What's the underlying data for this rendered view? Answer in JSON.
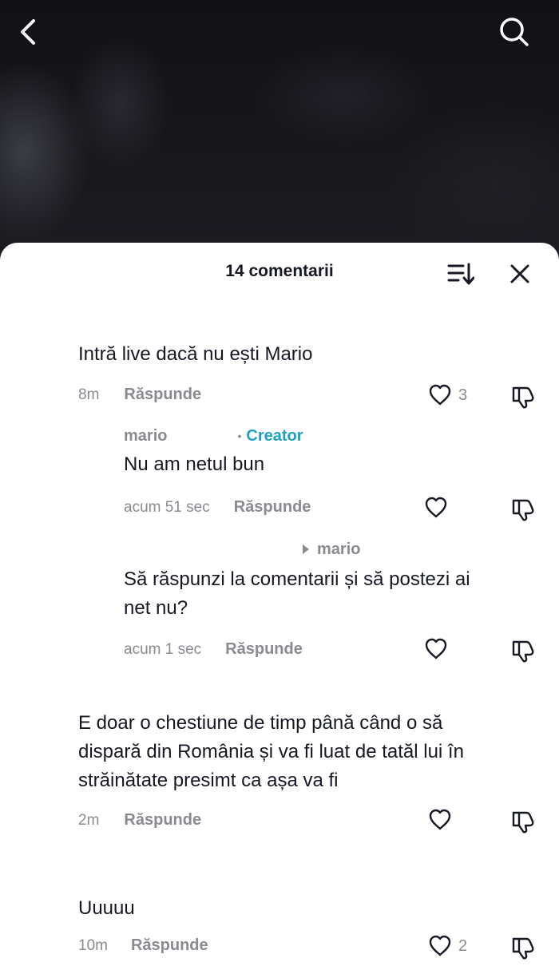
{
  "header": {
    "back_icon": "chevron-left-icon",
    "search_icon": "search-icon"
  },
  "sheet": {
    "title": "14 comentarii",
    "sort_icon": "sort-icon",
    "close_icon": "close-icon"
  },
  "comments": [
    {
      "text": "Intră live dacă nu ești Mario",
      "time": "8m",
      "reply_label": "Răspunde",
      "likes": "3"
    },
    {
      "username": "mario",
      "badge": "Creator",
      "text": "Nu am netul bun",
      "time": "acum 51 sec",
      "reply_label": "Răspunde",
      "likes": ""
    },
    {
      "reply_to": "mario",
      "text_line1": "Să răspunzi la comentarii și să postezi ai",
      "text_line2": "net nu?",
      "time": "acum 1 sec",
      "reply_label": "Răspunde",
      "likes": ""
    },
    {
      "text_line1": "E doar o chestiune de timp până când o să",
      "text_line2": "dispară din România și va fi luat de tatăl lui în",
      "text_line3": "străinătate presimt ca așa va fi",
      "time": "2m",
      "reply_label": "Răspunde",
      "likes": ""
    },
    {
      "text": "Uuuuu",
      "time": "10m",
      "reply_label": "Răspunde",
      "likes": "2"
    }
  ],
  "colors": {
    "accent_creator": "#1fa1c2",
    "muted": "#8a8b91",
    "text": "#161823"
  }
}
